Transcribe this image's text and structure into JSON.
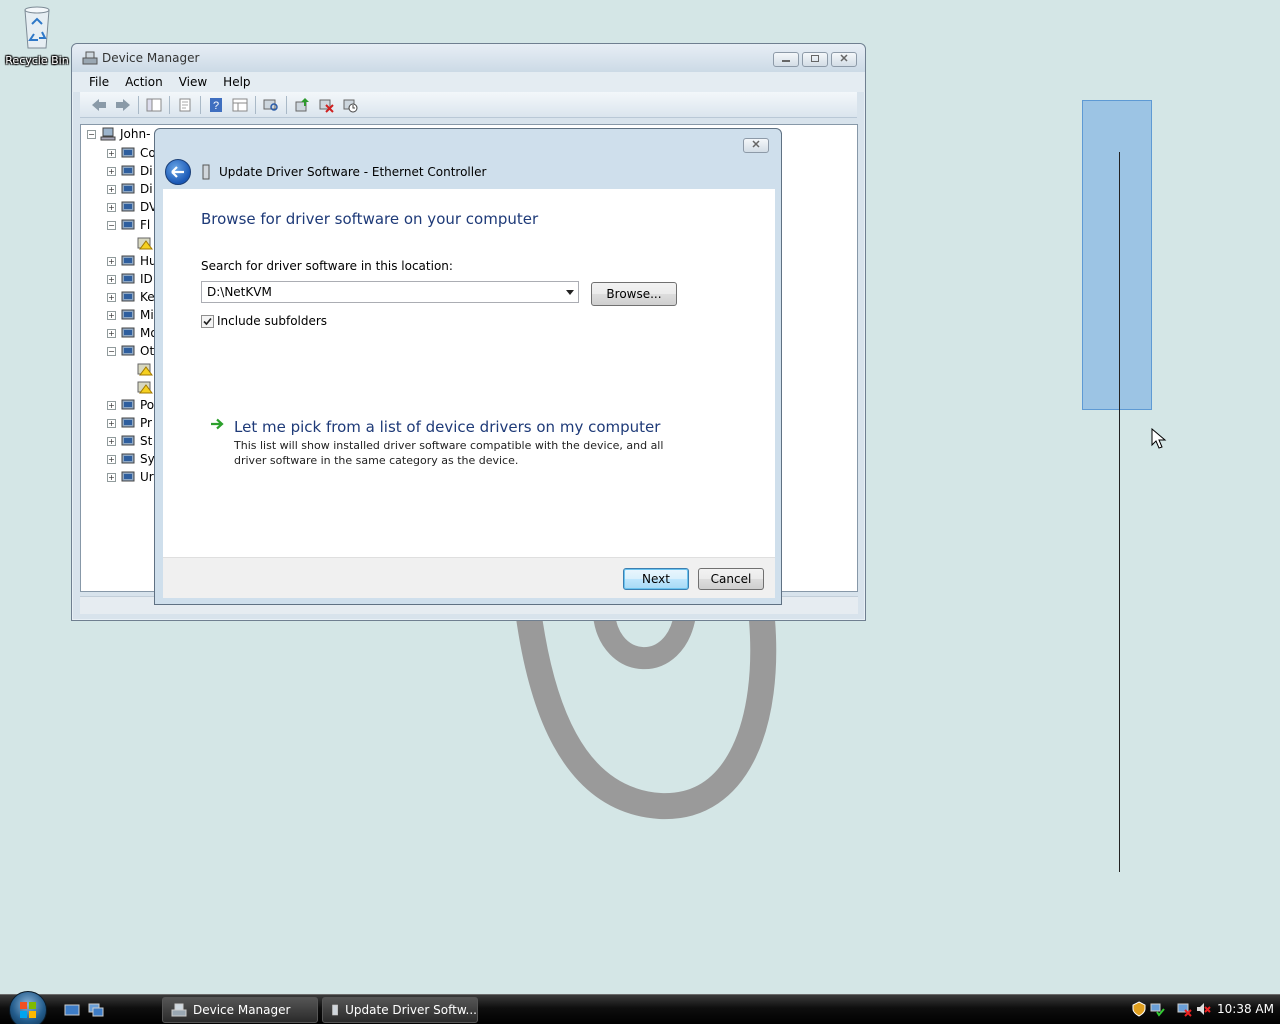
{
  "desktop": {
    "recycle_bin_label": "Recycle Bin"
  },
  "device_manager": {
    "title": "Device Manager",
    "menu": [
      "File",
      "Action",
      "View",
      "Help"
    ],
    "tree_root": "John-",
    "tree_items": [
      {
        "label": "Co",
        "icon": "computer-icon",
        "expander": "+"
      },
      {
        "label": "Di",
        "icon": "disk-drive-icon",
        "expander": "+"
      },
      {
        "label": "Di",
        "icon": "display-adapter-icon",
        "expander": "+"
      },
      {
        "label": "DV",
        "icon": "dvd-drive-icon",
        "expander": "+"
      },
      {
        "label": "Fl",
        "icon": "floppy-controller-icon",
        "expander": "-"
      },
      {
        "label": "",
        "icon": "warning-device-icon",
        "expander": ""
      },
      {
        "label": "Hu",
        "icon": "hid-icon",
        "expander": "+"
      },
      {
        "label": "ID",
        "icon": "ide-controller-icon",
        "expander": "+"
      },
      {
        "label": "Ke",
        "icon": "keyboard-icon",
        "expander": "+"
      },
      {
        "label": "Mi",
        "icon": "mouse-icon",
        "expander": "+"
      },
      {
        "label": "Mo",
        "icon": "monitor-icon",
        "expander": "+"
      },
      {
        "label": "Ot",
        "icon": "other-devices-icon",
        "expander": "-"
      },
      {
        "label": "",
        "icon": "warning-device-icon",
        "expander": ""
      },
      {
        "label": "",
        "icon": "warning-device-icon",
        "expander": ""
      },
      {
        "label": "Po",
        "icon": "ports-icon",
        "expander": "+"
      },
      {
        "label": "Pr",
        "icon": "processor-icon",
        "expander": "+"
      },
      {
        "label": "St",
        "icon": "storage-icon",
        "expander": "+"
      },
      {
        "label": "Sy",
        "icon": "system-devices-icon",
        "expander": "+"
      },
      {
        "label": "Ur",
        "icon": "usb-icon",
        "expander": "+"
      }
    ]
  },
  "dialog": {
    "title": "Update Driver Software - Ethernet Controller",
    "heading": "Browse for driver software on your computer",
    "search_label": "Search for driver software in this location:",
    "path_value": "D:\\NetKVM",
    "browse_label": "Browse...",
    "include_subfolders_label": "Include subfolders",
    "include_subfolders_checked": true,
    "pick_link": "Let me pick from a list of device drivers on my computer",
    "pick_desc": "This list will show installed driver software compatible with the device, and all driver software in the same category as the device.",
    "next_label": "Next",
    "cancel_label": "Cancel"
  },
  "taskbar": {
    "buttons": [
      {
        "label": "Device Manager",
        "icon": "device-manager-icon"
      },
      {
        "label": "Update Driver Softw...",
        "icon": "driver-icon"
      }
    ],
    "clock": "10:38 AM"
  },
  "colors": {
    "desktop_bg": "#d4e6e6",
    "selection": "#9cc4e4",
    "heading_blue": "#1e3a78"
  }
}
